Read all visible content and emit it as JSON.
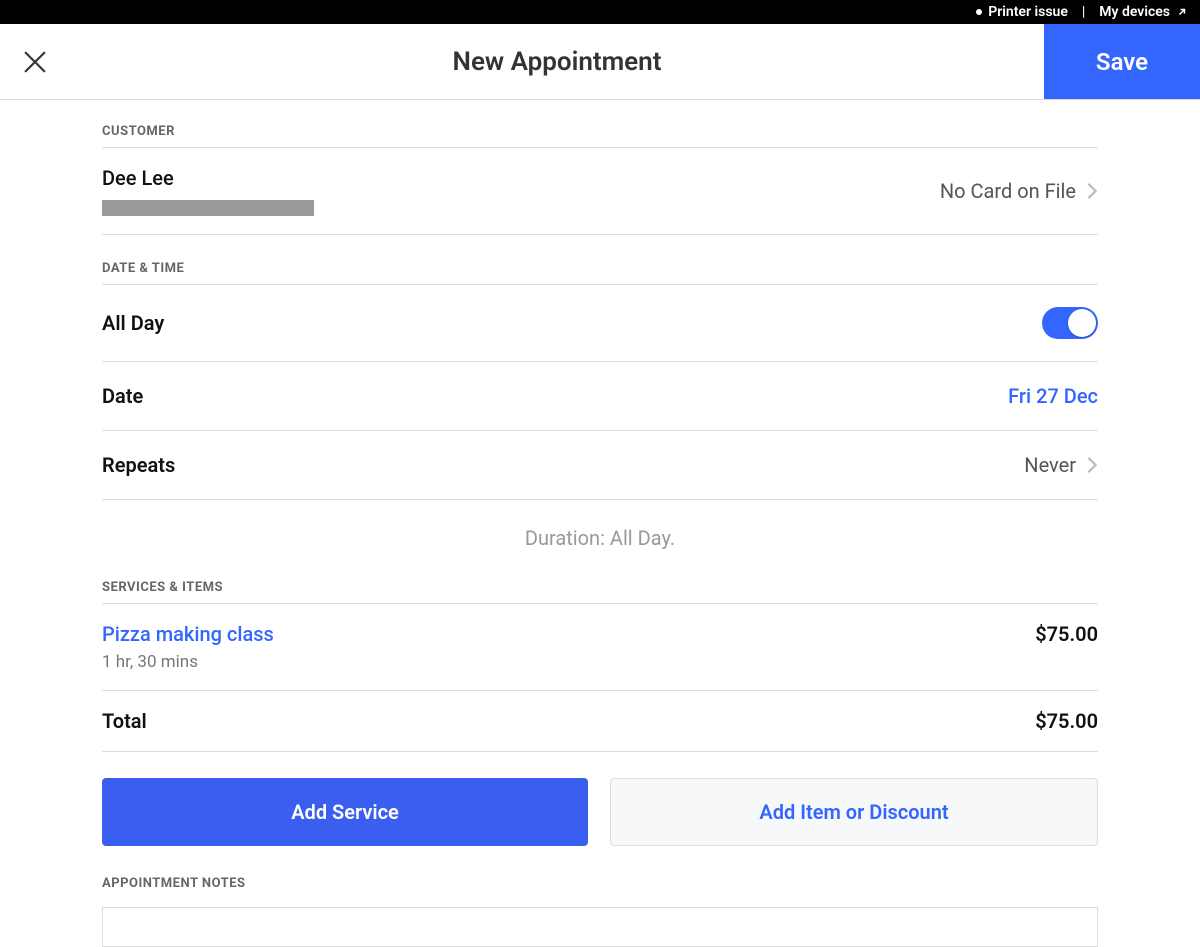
{
  "status_bar": {
    "printer_issue": "Printer issue",
    "my_devices": "My devices"
  },
  "header": {
    "title": "New Appointment",
    "save": "Save"
  },
  "sections": {
    "customer_label": "CUSTOMER",
    "datetime_label": "DATE & TIME",
    "services_label": "SERVICES & ITEMS",
    "notes_label": "APPOINTMENT NOTES"
  },
  "customer": {
    "name": "Dee Lee",
    "card_status": "No Card on File"
  },
  "datetime": {
    "all_day_label": "All Day",
    "all_day_on": true,
    "date_label": "Date",
    "date_value": "Fri 27 Dec",
    "repeats_label": "Repeats",
    "repeats_value": "Never",
    "duration_text": "Duration: All Day."
  },
  "services": {
    "items": [
      {
        "name": "Pizza making class",
        "duration": "1 hr, 30 mins",
        "price": "$75.00"
      }
    ],
    "total_label": "Total",
    "total_value": "$75.00"
  },
  "actions": {
    "add_service": "Add Service",
    "add_item_discount": "Add Item or Discount"
  }
}
